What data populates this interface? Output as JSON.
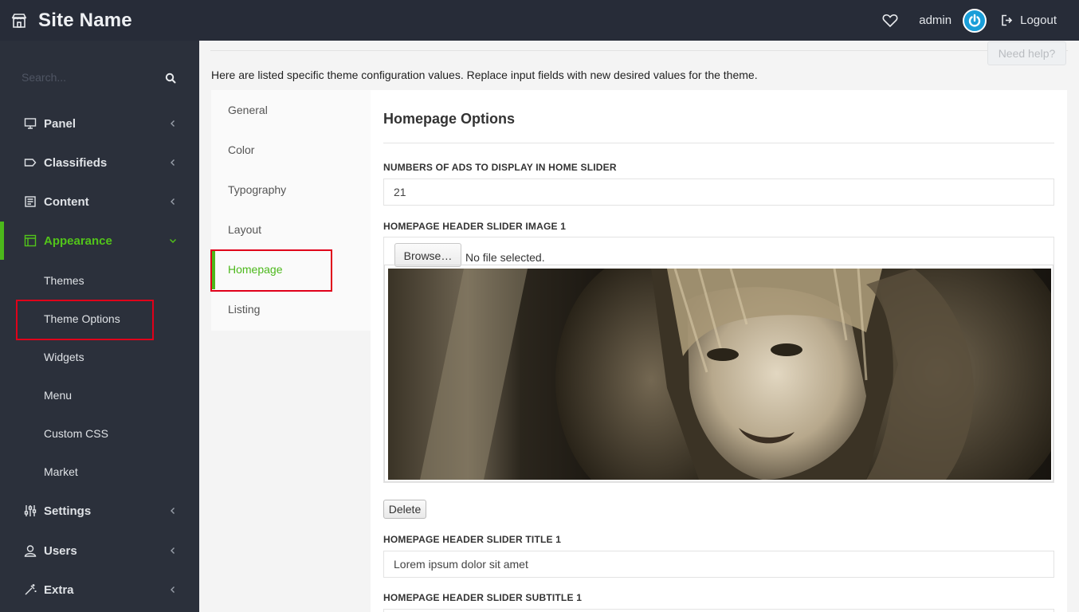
{
  "topbar": {
    "site_name": "Site Name",
    "user": "admin",
    "logout": "Logout"
  },
  "sidebar": {
    "search_placeholder": "Search...",
    "items": [
      {
        "label": "Panel",
        "icon": "monitor-icon"
      },
      {
        "label": "Classifieds",
        "icon": "tag-icon"
      },
      {
        "label": "Content",
        "icon": "newspaper-icon"
      },
      {
        "label": "Appearance",
        "icon": "layout-icon",
        "active": true
      },
      {
        "label": "Settings",
        "icon": "sliders-icon"
      },
      {
        "label": "Users",
        "icon": "user-icon"
      },
      {
        "label": "Extra",
        "icon": "magic-icon"
      }
    ],
    "appearance_sub": [
      "Themes",
      "Theme Options",
      "Widgets",
      "Menu",
      "Custom CSS",
      "Market"
    ]
  },
  "main": {
    "help": "Need help?",
    "intro": "Here are listed specific theme configuration values. Replace input fields with new desired values for the theme.",
    "tabs": [
      "General",
      "Color",
      "Typography",
      "Layout",
      "Homepage",
      "Listing"
    ],
    "active_tab": "Homepage",
    "section_title": "Homepage Options",
    "fields": {
      "ads_label": "NUMBERS OF ADS TO DISPLAY IN HOME SLIDER",
      "ads_value": "21",
      "image1_label": "HOMEPAGE HEADER SLIDER IMAGE 1",
      "browse": "Browse…",
      "file_status": "No file selected.",
      "delete": "Delete",
      "title1_label": "HOMEPAGE HEADER SLIDER TITLE 1",
      "title1_value": "Lorem ipsum dolor sit amet",
      "subtitle1_label": "HOMEPAGE HEADER SLIDER SUBTITLE 1"
    }
  },
  "colors": {
    "accent": "#4cb81b",
    "sidebar_bg": "#2b303b",
    "topbar_bg": "#272c38",
    "highlight": "#e0001a"
  }
}
